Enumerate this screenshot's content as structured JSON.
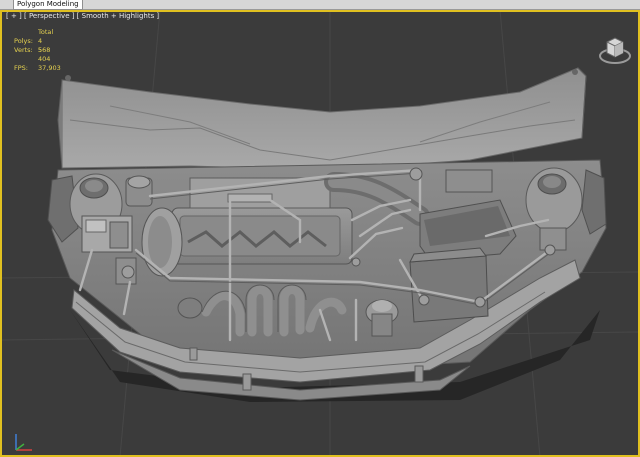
{
  "ribbon": {
    "tab_label": "Polygon Modeling"
  },
  "viewport": {
    "label_parts": [
      "[ + ]",
      "[ Perspective ]",
      "[ Smooth + Highlights ]"
    ],
    "label": "[ + ] [ Perspective ] [ Smooth + Highlights ]"
  },
  "stats": {
    "header": "Total",
    "polys_label": "Polys:",
    "polys_value": "4 568",
    "verts_label": "Verts:",
    "verts_value": "5 404",
    "fps_label": "FPS:",
    "fps_value": "37,903"
  },
  "icons": {
    "viewcube": "viewcube-icon",
    "axis": "axis-tripod-icon"
  },
  "colors": {
    "viewport_border": "#e0c020",
    "stats_text": "#e6d250",
    "background": "#3b3b3b"
  }
}
